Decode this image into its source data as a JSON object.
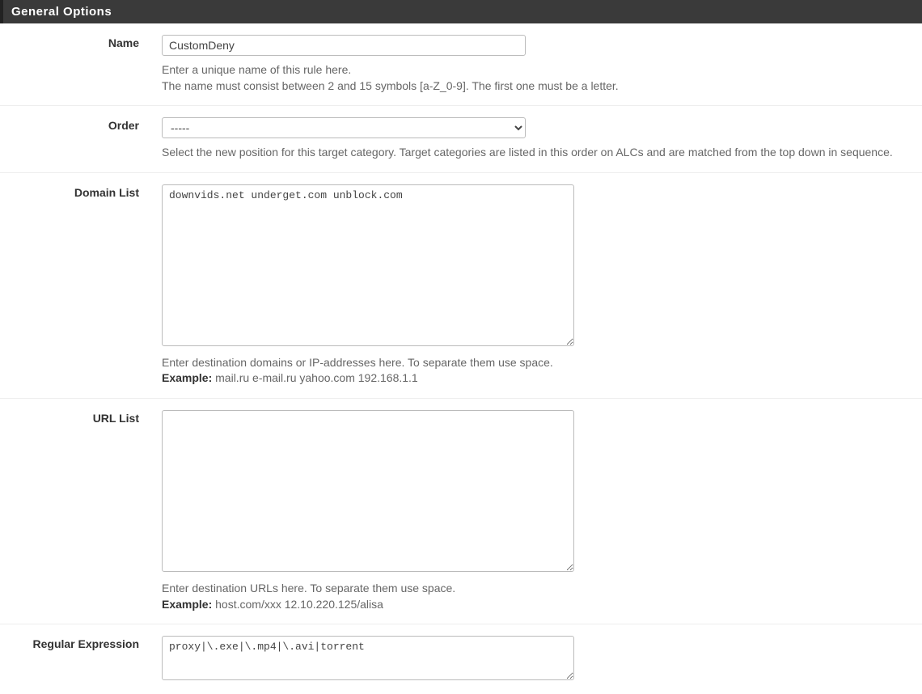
{
  "sectionTitle": "General Options",
  "name": {
    "label": "Name",
    "value": "CustomDeny",
    "help1": "Enter a unique name of this rule here.",
    "help2": "The name must consist between 2 and 15 symbols [a-Z_0-9]. The first one must be a letter."
  },
  "order": {
    "label": "Order",
    "value": "-----",
    "help": "Select the new position for this target category. Target categories are listed in this order on ALCs and are matched from the top down in sequence."
  },
  "domainList": {
    "label": "Domain List",
    "value": "downvids.net underget.com unblock.com",
    "help1": "Enter destination domains or IP-addresses here. To separate them use space.",
    "exampleLabel": "Example:",
    "exampleText": " mail.ru e-mail.ru yahoo.com 192.168.1.1"
  },
  "urlList": {
    "label": "URL List",
    "value": "",
    "help1": "Enter destination URLs here. To separate them use space.",
    "exampleLabel": "Example:",
    "exampleText": " host.com/xxx 12.10.220.125/alisa"
  },
  "regex": {
    "label": "Regular Expression",
    "value": "proxy|\\.exe|\\.mp4|\\.avi|torrent"
  }
}
